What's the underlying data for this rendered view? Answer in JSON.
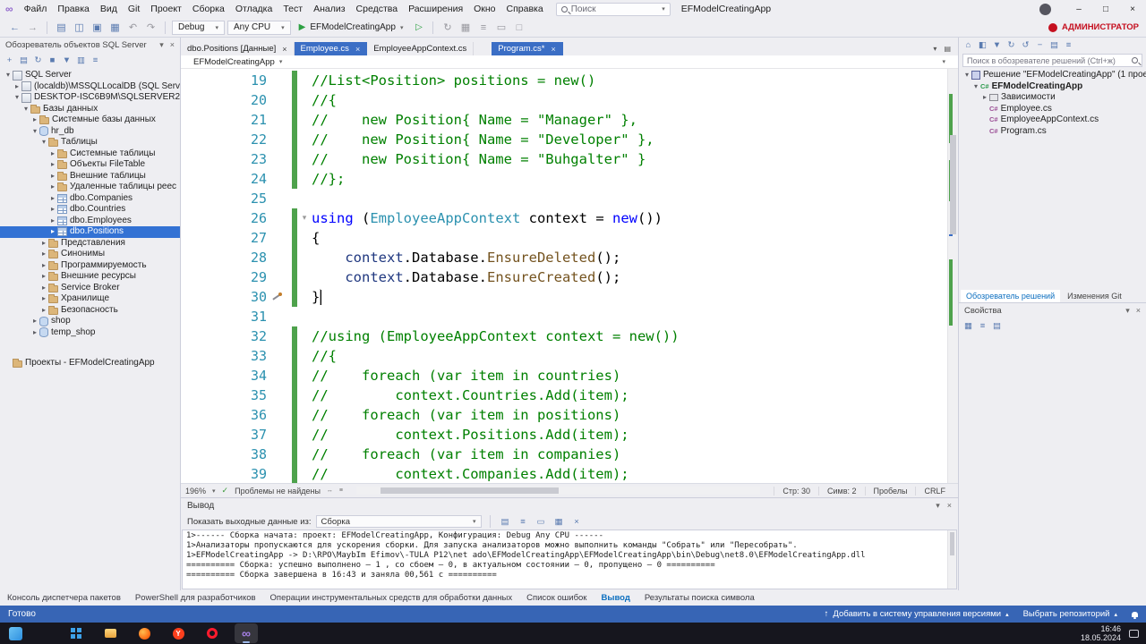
{
  "window": {
    "search_placeholder": "Поиск",
    "title": "EFModelCreatingApp",
    "admin_label": "АДМИНИСТРАТОР",
    "controls": {
      "minimize": "–",
      "maximize": "□",
      "close": "×"
    }
  },
  "menu": {
    "items": [
      "Файл",
      "Правка",
      "Вид",
      "Git",
      "Проект",
      "Сборка",
      "Отладка",
      "Тест",
      "Анализ",
      "Средства",
      "Расширения",
      "Окно",
      "Справка"
    ]
  },
  "toolbar": {
    "configuration": "Debug",
    "platform": "Any CPU",
    "run_label": "EFModelCreatingApp"
  },
  "sql_explorer": {
    "title": "Обозреватель объектов SQL Server",
    "tree": [
      {
        "label": "SQL Server",
        "level": 0,
        "exp": "down",
        "icon": "server"
      },
      {
        "label": "(localdb)\\MSSQLLocalDB (SQL Server 15",
        "level": 1,
        "exp": "right",
        "icon": "server"
      },
      {
        "label": "DESKTOP-ISC6B9M\\SQLSERVER2022 (S",
        "level": 1,
        "exp": "down",
        "icon": "server"
      },
      {
        "label": "Базы данных",
        "level": 2,
        "exp": "down",
        "icon": "folder"
      },
      {
        "label": "Системные базы данных",
        "level": 3,
        "exp": "right",
        "icon": "folder"
      },
      {
        "label": "hr_db",
        "level": 3,
        "exp": "down",
        "icon": "db"
      },
      {
        "label": "Таблицы",
        "level": 4,
        "exp": "down",
        "icon": "folder"
      },
      {
        "label": "Системные таблицы",
        "level": 5,
        "exp": "right",
        "icon": "folder"
      },
      {
        "label": "Объекты FileTable",
        "level": 5,
        "exp": "right",
        "icon": "folder"
      },
      {
        "label": "Внешние таблицы",
        "level": 5,
        "exp": "right",
        "icon": "folder"
      },
      {
        "label": "Удаленные таблицы реес",
        "level": 5,
        "exp": "right",
        "icon": "folder"
      },
      {
        "label": "dbo.Companies",
        "level": 5,
        "exp": "right",
        "icon": "table"
      },
      {
        "label": "dbo.Countries",
        "level": 5,
        "exp": "right",
        "icon": "table"
      },
      {
        "label": "dbo.Employees",
        "level": 5,
        "exp": "right",
        "icon": "table"
      },
      {
        "label": "dbo.Positions",
        "level": 5,
        "exp": "right",
        "icon": "table",
        "selected": true
      },
      {
        "label": "Представления",
        "level": 4,
        "exp": "right",
        "icon": "folder"
      },
      {
        "label": "Синонимы",
        "level": 4,
        "exp": "right",
        "icon": "folder"
      },
      {
        "label": "Программируемость",
        "level": 4,
        "exp": "right",
        "icon": "folder"
      },
      {
        "label": "Внешние ресурсы",
        "level": 4,
        "exp": "right",
        "icon": "folder"
      },
      {
        "label": "Service Broker",
        "level": 4,
        "exp": "right",
        "icon": "folder"
      },
      {
        "label": "Хранилище",
        "level": 4,
        "exp": "right",
        "icon": "folder"
      },
      {
        "label": "Безопасность",
        "level": 4,
        "exp": "right",
        "icon": "folder"
      },
      {
        "label": "shop",
        "level": 3,
        "exp": "right",
        "icon": "db"
      },
      {
        "label": "temp_shop",
        "level": 3,
        "exp": "right",
        "icon": "db"
      },
      {
        "label": "Проекты - EFModelCreatingApp",
        "level": 0,
        "exp": "none",
        "icon": "folder",
        "gap": true
      }
    ]
  },
  "editor": {
    "tabs": [
      {
        "label": "dbo.Positions [Данные]",
        "active": false,
        "closable": true
      },
      {
        "label": "Employee.cs",
        "active": true,
        "closable": true
      },
      {
        "label": "EmployeeAppContext.cs",
        "active": false,
        "closable": false
      },
      {
        "label": "Program.cs*",
        "active": true,
        "closable": true,
        "gap_before": true
      }
    ],
    "breadcrumb": "EFModelCreatingApp",
    "status": {
      "zoom": "196%",
      "problems": "Проблемы не найдены",
      "line": "Стр: 30",
      "column": "Симв: 2",
      "spaces": "Пробелы",
      "line_ending": "CRLF"
    },
    "code": {
      "lines": [
        {
          "num": 19,
          "bar": true,
          "tokens": [
            {
              "t": "//List<Position> positions = new()",
              "c": "comment"
            }
          ]
        },
        {
          "num": 20,
          "bar": true,
          "tokens": [
            {
              "t": "//{",
              "c": "comment"
            }
          ]
        },
        {
          "num": 21,
          "bar": true,
          "tokens": [
            {
              "t": "//    new Position{ Name = \"Manager\" },",
              "c": "comment"
            }
          ]
        },
        {
          "num": 22,
          "bar": true,
          "tokens": [
            {
              "t": "//    new Position{ Name = \"Developer\" },",
              "c": "comment"
            }
          ]
        },
        {
          "num": 23,
          "bar": true,
          "tokens": [
            {
              "t": "//    new Position{ Name = \"Buhgalter\" }",
              "c": "comment"
            }
          ]
        },
        {
          "num": 24,
          "bar": true,
          "tokens": [
            {
              "t": "//};",
              "c": "comment"
            }
          ]
        },
        {
          "num": 25,
          "bar": false,
          "tokens": []
        },
        {
          "num": 26,
          "bar": true,
          "fold": true,
          "tokens": [
            {
              "t": "using",
              "c": "keyword"
            },
            {
              "t": " (",
              "c": "plain"
            },
            {
              "t": "EmployeeAppContext",
              "c": "type"
            },
            {
              "t": " context = ",
              "c": "plain"
            },
            {
              "t": "new",
              "c": "keyword"
            },
            {
              "t": "())",
              "c": "plain"
            }
          ]
        },
        {
          "num": 27,
          "bar": true,
          "tokens": [
            {
              "t": "{",
              "c": "plain"
            }
          ]
        },
        {
          "num": 28,
          "bar": true,
          "tokens": [
            {
              "t": "    ",
              "c": "plain"
            },
            {
              "t": "context",
              "c": "local"
            },
            {
              "t": ".Database.",
              "c": "plain"
            },
            {
              "t": "EnsureDeleted",
              "c": "method"
            },
            {
              "t": "();",
              "c": "plain"
            }
          ]
        },
        {
          "num": 29,
          "bar": true,
          "tokens": [
            {
              "t": "    ",
              "c": "plain"
            },
            {
              "t": "context",
              "c": "local"
            },
            {
              "t": ".Database.",
              "c": "plain"
            },
            {
              "t": "EnsureCreated",
              "c": "method"
            },
            {
              "t": "();",
              "c": "plain"
            }
          ]
        },
        {
          "num": 30,
          "bar": true,
          "current": true,
          "icon": "screwdriver",
          "cursor": true,
          "tokens": [
            {
              "t": "}",
              "c": "plain",
              "box": true
            }
          ]
        },
        {
          "num": 31,
          "bar": false,
          "tokens": []
        },
        {
          "num": 32,
          "bar": true,
          "tokens": [
            {
              "t": "//using (EmployeeAppContext context = new())",
              "c": "comment"
            }
          ]
        },
        {
          "num": 33,
          "bar": true,
          "tokens": [
            {
              "t": "//{",
              "c": "comment"
            }
          ]
        },
        {
          "num": 34,
          "bar": true,
          "tokens": [
            {
              "t": "//    foreach (var item in countries)",
              "c": "comment"
            }
          ]
        },
        {
          "num": 35,
          "bar": true,
          "tokens": [
            {
              "t": "//        context.Countries.Add(item);",
              "c": "comment"
            }
          ]
        },
        {
          "num": 36,
          "bar": true,
          "tokens": [
            {
              "t": "//    foreach (var item in positions)",
              "c": "comment"
            }
          ]
        },
        {
          "num": 37,
          "bar": true,
          "tokens": [
            {
              "t": "//        context.Positions.Add(item);",
              "c": "comment"
            }
          ]
        },
        {
          "num": 38,
          "bar": true,
          "tokens": [
            {
              "t": "//    foreach (var item in companies)",
              "c": "comment"
            }
          ]
        },
        {
          "num": 39,
          "bar": true,
          "tokens": [
            {
              "t": "//        context.Companies.Add(item);",
              "c": "comment"
            }
          ]
        }
      ]
    }
  },
  "solution_explorer": {
    "search_placeholder": "Поиск в обозревателе решений (Ctrl+ж)",
    "tree": [
      {
        "label": "Решение \"EFModelCreatingApp\" (1 проект",
        "level": 0,
        "exp": "down",
        "icon": "sln"
      },
      {
        "label": "EFModelCreatingApp",
        "level": 1,
        "exp": "down",
        "icon": "csproj",
        "bold": true
      },
      {
        "label": "Зависимости",
        "level": 2,
        "exp": "right",
        "icon": "deps"
      },
      {
        "label": "Employee.cs",
        "level": 2,
        "exp": "none",
        "icon": "cs"
      },
      {
        "label": "EmployeeAppContext.cs",
        "level": 2,
        "exp": "none",
        "icon": "cs"
      },
      {
        "label": "Program.cs",
        "level": 2,
        "exp": "none",
        "icon": "cs"
      }
    ],
    "tabs": [
      {
        "label": "Обозреватель решений",
        "active": true
      },
      {
        "label": "Изменения Git",
        "active": false
      }
    ]
  },
  "properties": {
    "title": "Свойства"
  },
  "output": {
    "title": "Вывод",
    "show_from_label": "Показать выходные данные из:",
    "source": "Сборка",
    "lines": [
      "1>------ Сборка начата: проект: EFModelCreatingApp, Конфигурация: Debug Any CPU ------",
      "1>Анализаторы пропускаются для ускорения сборки. Для запуска анализаторов можно выполнить команды \"Собрать\" или \"Пересобрать\".",
      "1>EFModelCreatingApp -> D:\\RPO\\MaybIm Efimov\\-TULA P12\\net ado\\EFModelCreatingApp\\EFModelCreatingApp\\bin\\Debug\\net8.0\\EFModelCreatingApp.dll",
      "========== Сборка: успешно выполнено — 1 , со сбоем — 0, в актуальном состоянии — 0, пропущено — 0 ==========",
      "========== Сборка завершена в 16:43 и заняла 00,561 с =========="
    ]
  },
  "bottom_tabs": [
    {
      "label": "Консоль диспетчера пакетов",
      "active": false
    },
    {
      "label": "PowerShell для разработчиков",
      "active": false
    },
    {
      "label": "Операции инструментальных средств для обработки данных",
      "active": false
    },
    {
      "label": "Список ошибок",
      "active": false
    },
    {
      "label": "Вывод",
      "active": true
    },
    {
      "label": "Результаты поиска символа",
      "active": false
    }
  ],
  "status_bar": {
    "ready": "Готово",
    "add_to_source_control": "Добавить в систему управления версиями",
    "select_repository": "Выбрать репозиторий"
  },
  "taskbar": {
    "time": "16:46",
    "date": "18.05.2024",
    "icons": [
      {
        "name": "start",
        "active": false
      },
      {
        "name": "explorer",
        "active": false
      },
      {
        "name": "firefox",
        "active": false
      },
      {
        "name": "yandex",
        "active": false,
        "glyph": "Y"
      },
      {
        "name": "opera",
        "active": false
      },
      {
        "name": "visual-studio",
        "active": true,
        "glyph": "∞"
      }
    ]
  }
}
